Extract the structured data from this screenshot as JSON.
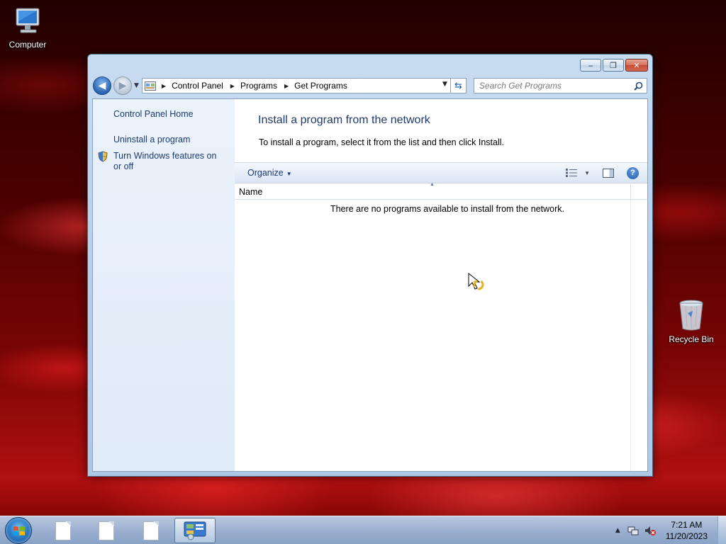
{
  "desktop": {
    "icons": [
      {
        "label": "Computer"
      },
      {
        "label": "Recycle Bin"
      }
    ]
  },
  "window": {
    "caption": {
      "minimize": "‒",
      "restore": "❐",
      "close": "✕"
    },
    "nav": {
      "back_icon": "back-arrow-icon",
      "forward_icon": "forward-arrow-icon"
    },
    "breadcrumb": [
      "Control Panel",
      "Programs",
      "Get Programs"
    ],
    "search": {
      "placeholder": "Search Get Programs"
    },
    "left_pane": {
      "home": "Control Panel Home",
      "uninstall": "Uninstall a program",
      "features": "Turn Windows features on or off"
    },
    "content": {
      "title": "Install a program from the network",
      "description": "To install a program, select it from the list and then click Install.",
      "organize": "Organize",
      "column_name": "Name",
      "empty_message": "There are no programs available to install from the network."
    }
  },
  "taskbar": {
    "clock": {
      "time": "7:21 AM",
      "date": "11/20/2023"
    },
    "items": [
      "document",
      "document",
      "document",
      "control-panel"
    ]
  },
  "colors": {
    "accent": "#1e3a6e",
    "taskbar": "#a8c6e6"
  }
}
